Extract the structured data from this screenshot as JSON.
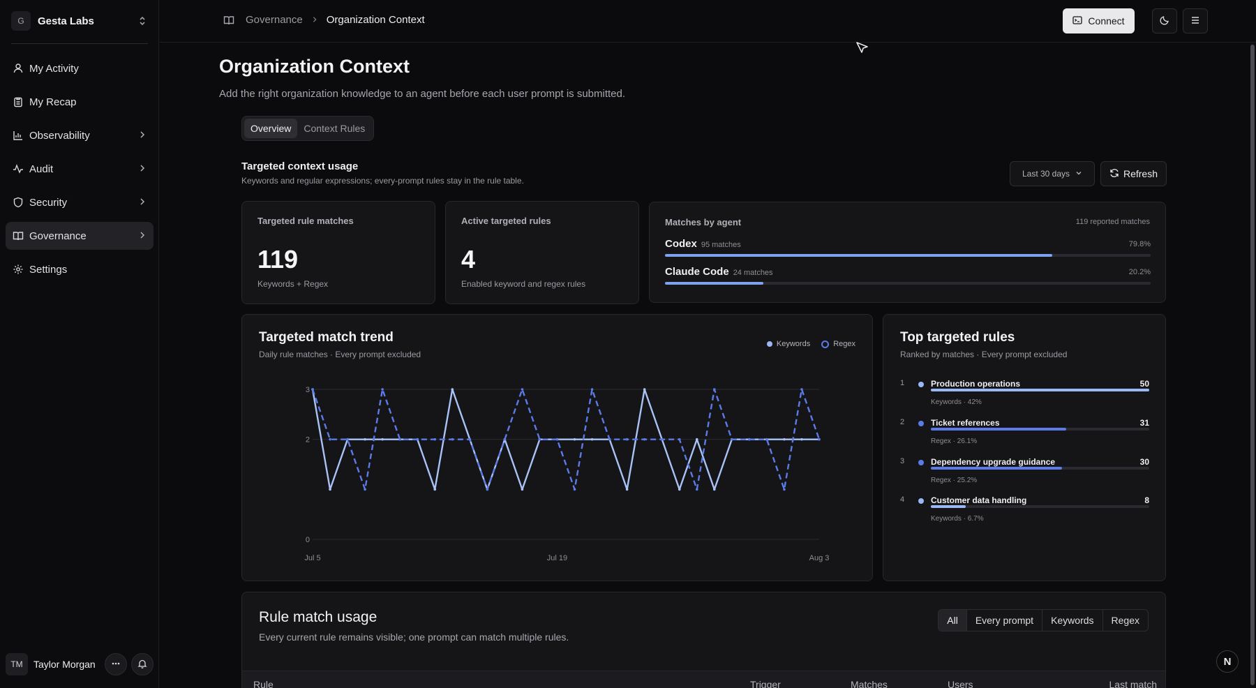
{
  "org": {
    "initial": "G",
    "name": "Gesta Labs"
  },
  "sidebar": {
    "items": [
      {
        "label": "My Activity",
        "icon": "user-icon"
      },
      {
        "label": "My Recap",
        "icon": "clipboard-icon"
      },
      {
        "label": "Observability",
        "icon": "bar-chart-icon"
      },
      {
        "label": "Audit",
        "icon": "activity-icon"
      },
      {
        "label": "Security",
        "icon": "shield-icon"
      },
      {
        "label": "Governance",
        "icon": "book-icon"
      },
      {
        "label": "Settings",
        "icon": "gear-icon"
      }
    ]
  },
  "user": {
    "initials": "TM",
    "name": "Taylor Morgan"
  },
  "breadcrumb": {
    "parent": "Governance",
    "current": "Organization Context"
  },
  "header": {
    "connect_label": "Connect"
  },
  "page": {
    "title": "Organization Context",
    "subtitle": "Add the right organization knowledge to an agent before each user prompt is submitted."
  },
  "tabs": [
    {
      "label": "Overview"
    },
    {
      "label": "Context Rules"
    }
  ],
  "usage_section": {
    "title": "Targeted context usage",
    "subtitle": "Keywords and regular expressions; every-prompt rules stay in the rule table.",
    "range_label": "Last 30 days",
    "refresh_label": "Refresh"
  },
  "stats": [
    {
      "label": "Targeted rule matches",
      "value": "119",
      "foot": "Keywords + Regex"
    },
    {
      "label": "Active targeted rules",
      "value": "4",
      "foot": "Enabled keyword and regex rules"
    }
  ],
  "agents": {
    "title": "Matches by agent",
    "total": "119 reported matches",
    "items": [
      {
        "name": "Codex",
        "matches": "95 matches",
        "pct": "79.8%",
        "fraction": 0.798
      },
      {
        "name": "Claude Code",
        "matches": "24 matches",
        "pct": "20.2%",
        "fraction": 0.202
      }
    ]
  },
  "trend": {
    "title": "Targeted match trend",
    "subtitle": "Daily rule matches · Every prompt excluded",
    "legend": {
      "keywords": "Keywords",
      "regex": "Regex"
    }
  },
  "chart_data": {
    "type": "line",
    "x_tick_labels": [
      "Jul 5",
      "Jul 19",
      "Aug 3"
    ],
    "y_tick_labels": [
      "0",
      "2",
      "3"
    ],
    "ylim": [
      0,
      3
    ],
    "x": [
      "Jul 5",
      "Jul 6",
      "Jul 7",
      "Jul 8",
      "Jul 9",
      "Jul 10",
      "Jul 11",
      "Jul 12",
      "Jul 13",
      "Jul 14",
      "Jul 15",
      "Jul 16",
      "Jul 17",
      "Jul 18",
      "Jul 19",
      "Jul 20",
      "Jul 21",
      "Jul 22",
      "Jul 23",
      "Jul 24",
      "Jul 25",
      "Jul 26",
      "Jul 27",
      "Jul 28",
      "Jul 29",
      "Jul 30",
      "Jul 31",
      "Aug 1",
      "Aug 2",
      "Aug 3"
    ],
    "series": [
      {
        "name": "Keywords",
        "values": [
          3,
          1,
          2,
          2,
          2,
          2,
          2,
          1,
          3,
          2,
          1,
          2,
          1,
          2,
          2,
          2,
          2,
          2,
          1,
          3,
          2,
          1,
          2,
          1,
          2,
          2,
          2,
          2,
          2,
          2
        ]
      },
      {
        "name": "Regex",
        "values": [
          3,
          2,
          2,
          1,
          3,
          2,
          2,
          2,
          2,
          2,
          1,
          2,
          3,
          2,
          2,
          1,
          3,
          2,
          2,
          2,
          2,
          2,
          1,
          3,
          2,
          2,
          2,
          1,
          3,
          2
        ]
      }
    ],
    "grid": true,
    "legend_position": "top-right"
  },
  "top_rules": {
    "title": "Top targeted rules",
    "subtitle": "Ranked by matches · Every prompt excluded",
    "items": [
      {
        "rank": "1",
        "name": "Production operations",
        "value": "50",
        "foot": "Keywords · 42%",
        "fraction": 1.0,
        "color": "#9ab8f6"
      },
      {
        "rank": "2",
        "name": "Ticket references",
        "value": "31",
        "foot": "Regex · 26.1%",
        "fraction": 0.62,
        "color": "#5b7be8"
      },
      {
        "rank": "3",
        "name": "Dependency upgrade guidance",
        "value": "30",
        "foot": "Regex · 25.2%",
        "fraction": 0.6,
        "color": "#5b7be8"
      },
      {
        "rank": "4",
        "name": "Customer data handling",
        "value": "8",
        "foot": "Keywords · 6.7%",
        "fraction": 0.16,
        "color": "#9ab8f6"
      }
    ]
  },
  "rule_usage": {
    "title": "Rule match usage",
    "subtitle": "Every current rule remains visible; one prompt can match multiple rules.",
    "filters": [
      "All",
      "Every prompt",
      "Keywords",
      "Regex"
    ],
    "columns": [
      "Rule",
      "Trigger",
      "Matches",
      "Users",
      "Last match"
    ]
  },
  "badge": {
    "letter": "N"
  }
}
